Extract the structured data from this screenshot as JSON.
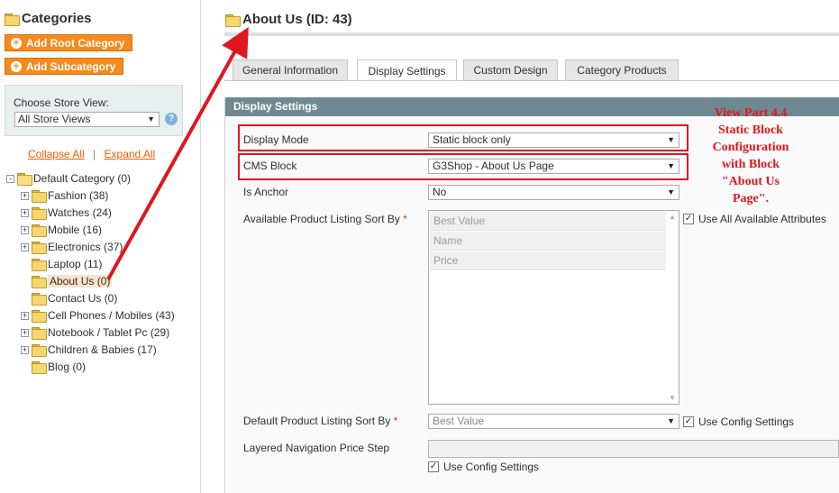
{
  "sidebar": {
    "title": "Categories",
    "add_root_label": "Add Root Category",
    "add_sub_label": "Add Subcategory",
    "store_view_label": "Choose Store View:",
    "store_view_value": "All Store Views",
    "collapse_all": "Collapse All",
    "separator": "|",
    "expand_all": "Expand All",
    "tree": [
      {
        "label": "Default Category (0)",
        "expander": "-"
      },
      {
        "label": "Fashion (38)",
        "expander": "+"
      },
      {
        "label": "Watches (24)",
        "expander": "+"
      },
      {
        "label": "Mobile (16)",
        "expander": "+"
      },
      {
        "label": "Electronics (37)",
        "expander": "+"
      },
      {
        "label": "Laptop (11)",
        "expander": ""
      },
      {
        "label": "About Us (0)",
        "expander": "",
        "selected": true
      },
      {
        "label": "Contact Us (0)",
        "expander": ""
      },
      {
        "label": "Cell Phones / Mobiles (43)",
        "expander": "+"
      },
      {
        "label": "Notebook / Tablet Pc (29)",
        "expander": "+"
      },
      {
        "label": "Children & Babies (17)",
        "expander": "+"
      },
      {
        "label": "Blog (0)",
        "expander": ""
      }
    ]
  },
  "main": {
    "title": "About Us (ID: 43)",
    "tabs": [
      {
        "label": "General Information",
        "active": false
      },
      {
        "label": "Display Settings",
        "active": true
      },
      {
        "label": "Custom Design",
        "active": false
      },
      {
        "label": "Category Products",
        "active": false
      }
    ],
    "panel_title": "Display Settings",
    "fields": {
      "display_mode": {
        "label": "Display Mode",
        "value": "Static block only"
      },
      "cms_block": {
        "label": "CMS Block",
        "value": "G3Shop - About Us Page"
      },
      "is_anchor": {
        "label": "Is Anchor",
        "value": "No"
      },
      "sort_by": {
        "label": "Available Product Listing Sort By",
        "required": "*",
        "options": [
          "Best Value",
          "Name",
          "Price"
        ],
        "use_all_label": "Use All Available Attributes",
        "use_all_checked": true
      },
      "default_sort": {
        "label": "Default Product Listing Sort By",
        "required": "*",
        "value": "Best Value",
        "use_config_label": "Use Config Settings",
        "use_config_checked": true
      },
      "price_step": {
        "label": "Layered Navigation Price Step",
        "use_config_label": "Use Config Settings",
        "use_config_checked": true
      }
    }
  },
  "annotation": {
    "lines": [
      "View Part 4.4",
      "Static Block",
      "Configuration",
      "with Block",
      "\"About Us",
      "Page\"."
    ]
  },
  "colors": {
    "accent_orange": "#f58a1d",
    "panel_header": "#6f8992",
    "annotation_red": "#e0161f"
  }
}
